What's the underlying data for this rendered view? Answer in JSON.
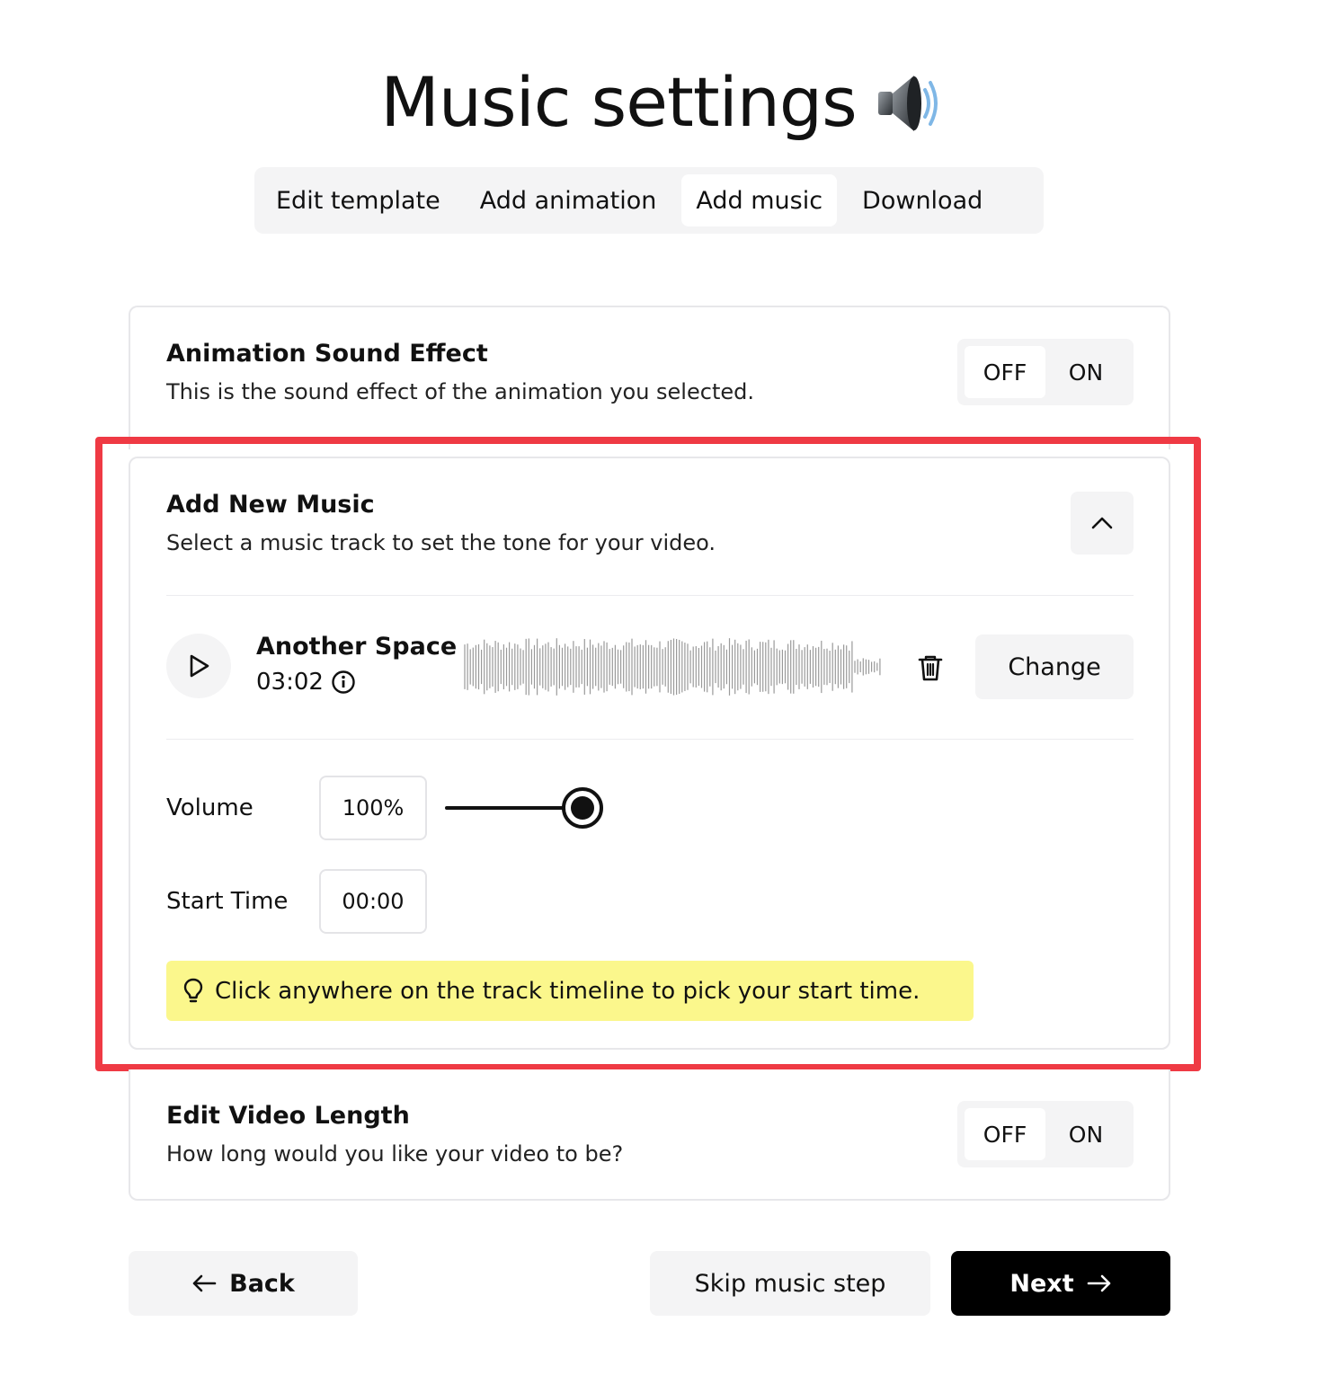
{
  "header": {
    "title": "Music settings",
    "title_icon": "speaker-icon"
  },
  "tabs": [
    {
      "label": "Edit template",
      "active": false
    },
    {
      "label": "Add animation",
      "active": false
    },
    {
      "label": "Add music",
      "active": true
    },
    {
      "label": "Download",
      "active": false
    }
  ],
  "sound_effect": {
    "title": "Animation Sound Effect",
    "description": "This is the sound effect of the animation you selected.",
    "toggle": {
      "off_label": "OFF",
      "on_label": "ON",
      "selected": "OFF"
    }
  },
  "add_music": {
    "title": "Add New Music",
    "description": "Select a music track to set the tone for your video.",
    "collapse_icon": "chevron-up-icon",
    "track": {
      "name": "Another Space",
      "duration": "03:02",
      "info_icon": "info-icon",
      "play_icon": "play-icon",
      "delete_icon": "trash-icon"
    },
    "change_label": "Change",
    "volume": {
      "label": "Volume",
      "value": "100%",
      "level": 1.0
    },
    "start_time": {
      "label": "Start Time",
      "value": "00:00"
    },
    "tip": {
      "icon": "lightbulb-icon",
      "text": "Click anywhere on the track timeline to pick your start time."
    }
  },
  "video_length": {
    "title": "Edit Video Length",
    "description": "How long would you like your video to be?",
    "toggle": {
      "off_label": "OFF",
      "on_label": "ON",
      "selected": "OFF"
    }
  },
  "footer": {
    "back_label": "Back",
    "skip_label": "Skip music step",
    "next_label": "Next"
  },
  "colors": {
    "highlight": "#ef3a44",
    "tip_background": "#fbf78c",
    "primary_button": "#000000",
    "surface": "#f4f4f5"
  }
}
